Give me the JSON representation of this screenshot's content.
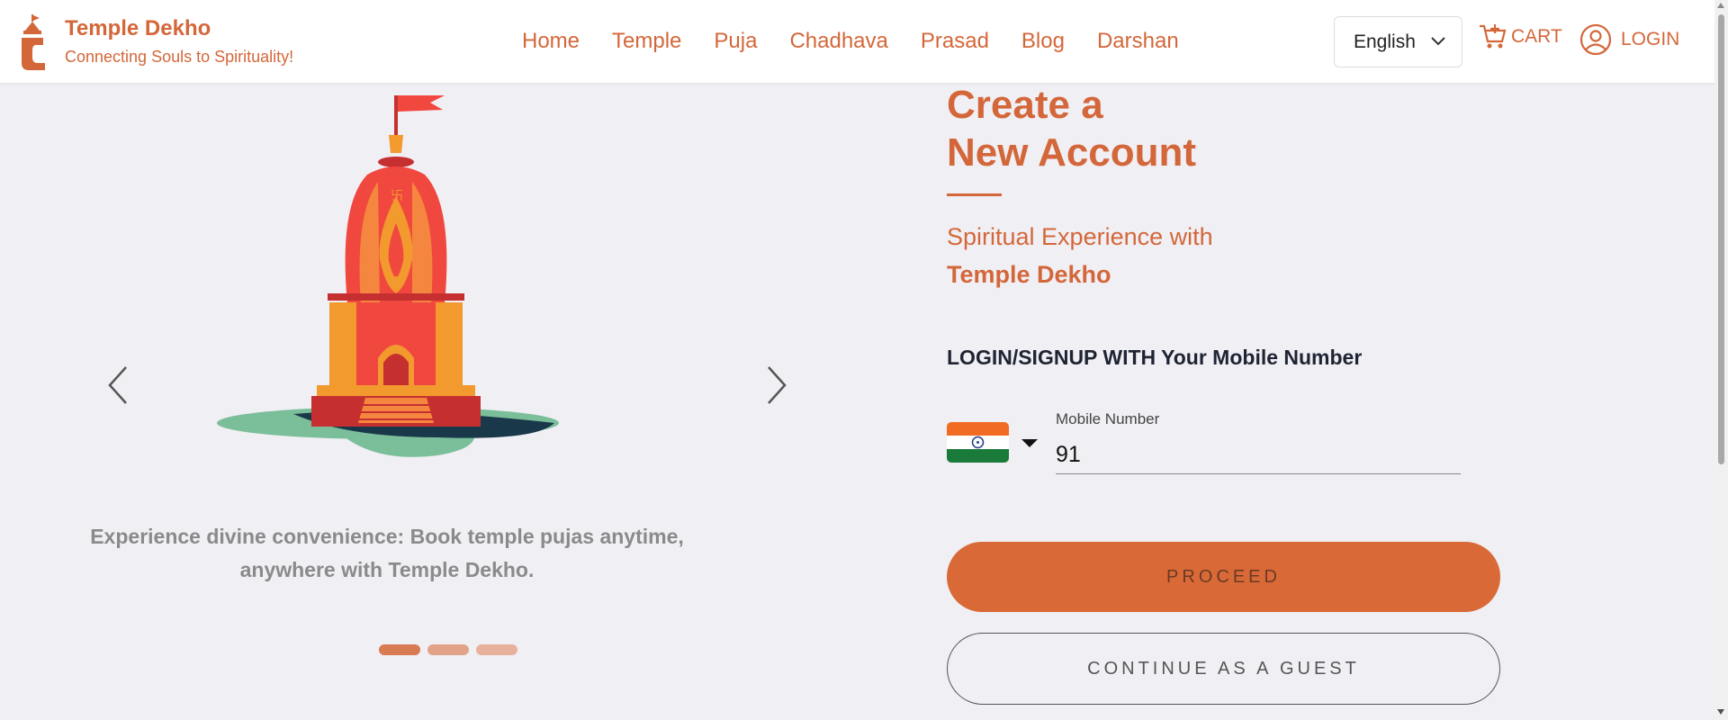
{
  "brand": {
    "name": "Temple Dekho",
    "tagline": "Connecting Souls to Spirituality!",
    "logo_icon": "temple-logo-icon",
    "accent_color": "#d4673a"
  },
  "nav": {
    "items": [
      {
        "label": "Home"
      },
      {
        "label": "Temple"
      },
      {
        "label": "Puja"
      },
      {
        "label": "Chadhava"
      },
      {
        "label": "Prasad"
      },
      {
        "label": "Blog"
      },
      {
        "label": "Darshan"
      }
    ]
  },
  "header_actions": {
    "language": "English",
    "cart_label": "CART",
    "login_label": "LOGIN"
  },
  "carousel": {
    "caption": "Experience divine convenience: Book temple pujas anytime, anywhere with Temple Dekho.",
    "slide_count": 3,
    "active_slide": 1
  },
  "form": {
    "title_line1": "Create a",
    "title_line2": "New Account",
    "subtitle_line1": "Spiritual Experience with",
    "subtitle_line2": "Temple Dekho",
    "login_heading": "LOGIN/SIGNUP WITH Your Mobile Number",
    "country_flag": "india-flag-icon",
    "mobile_label": "Mobile Number",
    "mobile_value": "91",
    "proceed_label": "PROCEED",
    "guest_label": "CONTINUE AS A GUEST"
  },
  "colors": {
    "background": "#f0eff4",
    "proceed_button": "#d96a38",
    "dot_active": "#d87b52",
    "dot_inactive": "#e2a287"
  }
}
